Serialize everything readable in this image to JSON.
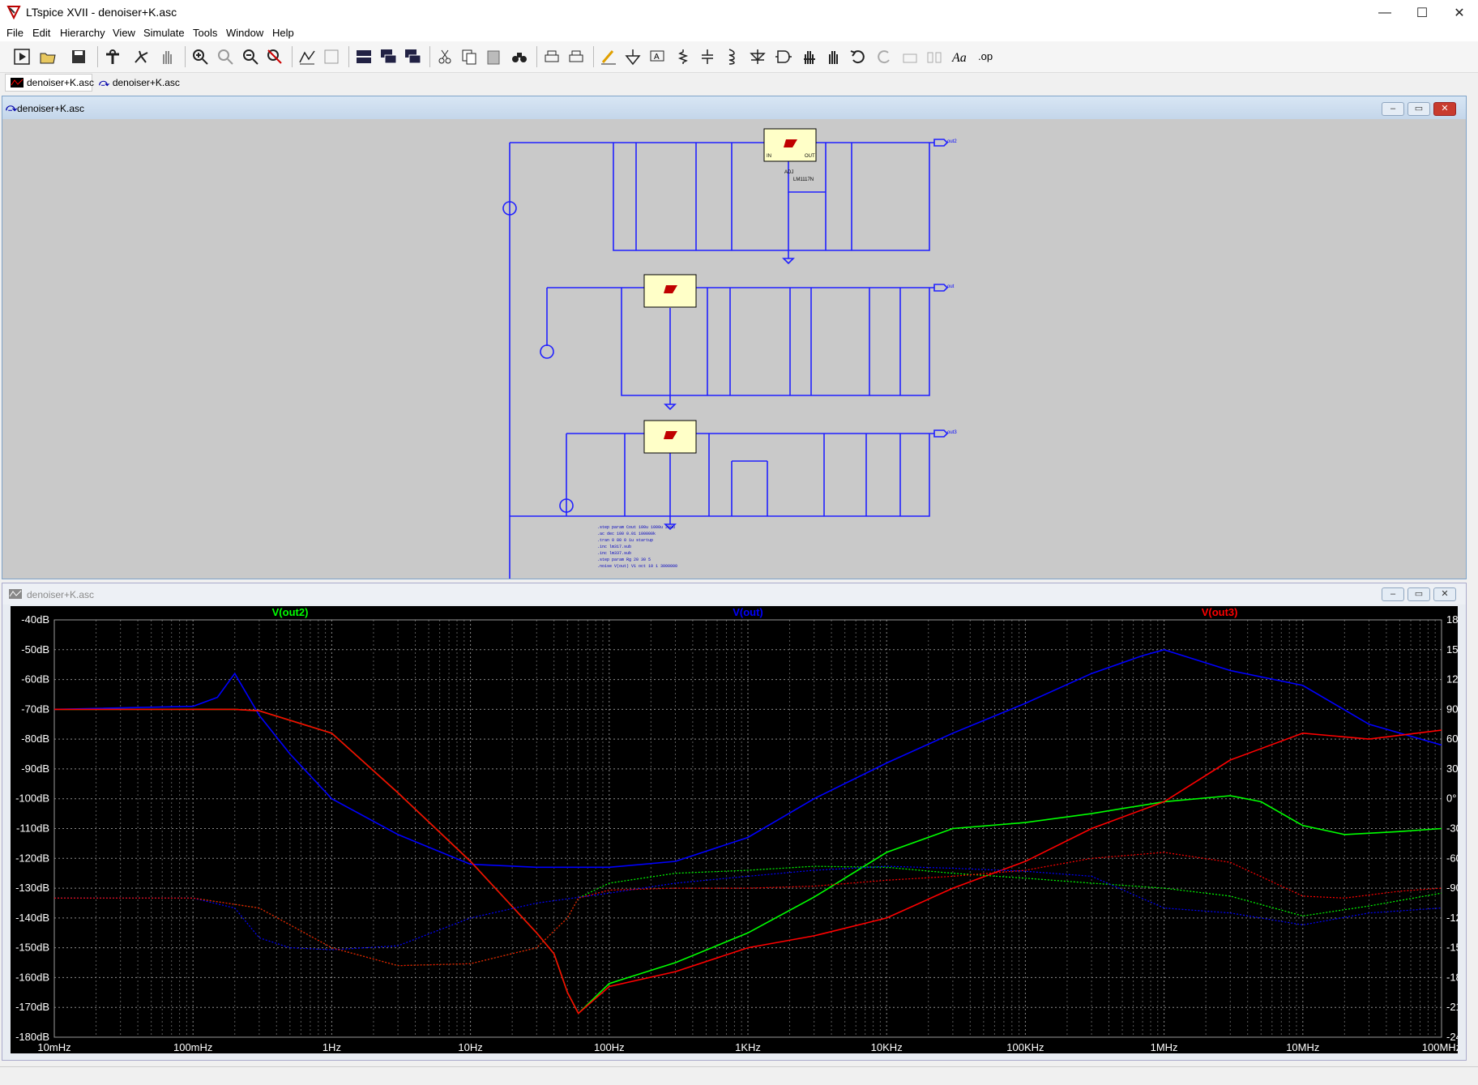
{
  "window": {
    "title": "LTspice XVII - denoiser+K.asc",
    "minimize": "—",
    "maximize": "☐",
    "close": "✕"
  },
  "menu": [
    {
      "label": "File"
    },
    {
      "label": "Edit"
    },
    {
      "label": "Hierarchy"
    },
    {
      "label": "View"
    },
    {
      "label": "Simulate"
    },
    {
      "label": "Tools"
    },
    {
      "label": "Window"
    },
    {
      "label": "Help"
    }
  ],
  "tabs": [
    {
      "label": "denoiser+K.asc",
      "icon": "waveform-icon"
    },
    {
      "label": "denoiser+K.asc",
      "icon": "schematic-icon"
    }
  ],
  "schematic": {
    "title": "denoiser+K.asc",
    "directives": [
      ".step param Cout 100u 1000u 200u",
      ".ac dec 100 0.01 100000k",
      ".tran 0 80 0 1u startup",
      ".inc lm317.sub",
      ".inc lm337.sub",
      ".step param Rg 20 30 5",
      ".noise V(out) V1 oct 10 1 3000000"
    ],
    "reg_labels": [
      "IN",
      "OUT",
      "ADJ",
      "LM1117N"
    ],
    "out_labels": [
      "out2",
      "out",
      "out3"
    ]
  },
  "plot": {
    "title": "denoiser+K.asc",
    "traces": [
      {
        "name": "V(out2)",
        "color": "#00ff00"
      },
      {
        "name": "V(out)",
        "color": "#0000ff"
      },
      {
        "name": "V(out3)",
        "color": "#ff0000"
      }
    ],
    "y_left": [
      "-40dB",
      "-50dB",
      "-60dB",
      "-70dB",
      "-80dB",
      "-90dB",
      "-100dB",
      "-110dB",
      "-120dB",
      "-130dB",
      "-140dB",
      "-150dB",
      "-160dB",
      "-170dB",
      "-180dB"
    ],
    "y_right": [
      "180°",
      "150°",
      "120°",
      "90°",
      "60°",
      "30°",
      "0°",
      "-30°",
      "-60°",
      "-90°",
      "-120°",
      "-150°",
      "-180°",
      "-210°",
      "-240°"
    ],
    "x_labels": [
      "10mHz",
      "100mHz",
      "1Hz",
      "10Hz",
      "100Hz",
      "1KHz",
      "10KHz",
      "100KHz",
      "1MHz",
      "10MHz",
      "100MHz"
    ]
  },
  "chart_data": {
    "type": "line",
    "x_scale": "log",
    "xlim_hz": [
      0.01,
      100000000
    ],
    "ylim_db": [
      -180,
      -40
    ],
    "ylim_phase_deg": [
      -240,
      180
    ],
    "grid": true,
    "series": [
      {
        "name": "V(out2)",
        "color": "#00ff00",
        "axis": "magnitude",
        "x": [
          0.01,
          0.1,
          0.2,
          0.3,
          1,
          3,
          10,
          30,
          40,
          50,
          60,
          100,
          300,
          1000,
          3000,
          10000,
          30000,
          100000,
          300000,
          1000000,
          3000000,
          5000000,
          10000000,
          20000000,
          50000000,
          100000000
        ],
        "y": [
          -70,
          -70,
          -70,
          -70.5,
          -78,
          -98,
          -121,
          -145,
          -152,
          -165,
          -172,
          -162,
          -155,
          -145,
          -133,
          -118,
          -110,
          -108,
          -105,
          -101,
          -99,
          -101,
          -109,
          -112,
          -111,
          -110
        ]
      },
      {
        "name": "V(out)",
        "color": "#0000ff",
        "axis": "magnitude",
        "x": [
          0.01,
          0.1,
          0.15,
          0.2,
          0.3,
          0.5,
          1,
          3,
          10,
          30,
          100,
          300,
          1000,
          3000,
          10000,
          30000,
          100000,
          300000,
          700000,
          1000000,
          3000000,
          10000000,
          30000000,
          100000000
        ],
        "y": [
          -70,
          -69,
          -66,
          -58,
          -72,
          -85,
          -100,
          -112,
          -122,
          -123,
          -123,
          -121,
          -113,
          -100,
          -88,
          -78,
          -68,
          -58,
          -52,
          -50,
          -57,
          -62,
          -75,
          -82
        ]
      },
      {
        "name": "V(out3)",
        "color": "#ff0000",
        "axis": "magnitude",
        "x": [
          0.01,
          0.1,
          0.2,
          0.3,
          1,
          3,
          10,
          30,
          40,
          50,
          60,
          100,
          300,
          1000,
          3000,
          10000,
          30000,
          100000,
          300000,
          1000000,
          3000000,
          10000000,
          30000000,
          100000000
        ],
        "y": [
          -70,
          -70,
          -70,
          -70.5,
          -78,
          -98,
          -121,
          -145,
          -152,
          -165,
          -172,
          -163,
          -158,
          -150,
          -146,
          -140,
          -130,
          -121,
          -110,
          -101,
          -87,
          -78,
          -80,
          -77
        ]
      },
      {
        "name": "V(out2) phase",
        "color": "#00ff00",
        "axis": "phase",
        "x": [
          0.01,
          0.1,
          0.3,
          1,
          3,
          10,
          30,
          50,
          60,
          100,
          300,
          1000,
          3000,
          10000,
          30000,
          100000,
          300000,
          1000000,
          3000000,
          10000000,
          30000000,
          100000000
        ],
        "y": [
          -100,
          -100,
          -110,
          -150,
          -168,
          -166,
          -150,
          -120,
          -100,
          -85,
          -75,
          -72,
          -68,
          -69,
          -75,
          -80,
          -85,
          -90,
          -98,
          -118,
          -108,
          -95
        ]
      },
      {
        "name": "V(out) phase",
        "color": "#0000ff",
        "axis": "phase",
        "x": [
          0.01,
          0.1,
          0.2,
          0.3,
          0.5,
          1,
          3,
          10,
          30,
          100,
          300,
          1000,
          3000,
          10000,
          30000,
          100000,
          300000,
          1000000,
          3000000,
          10000000,
          30000000,
          100000000
        ],
        "y": [
          -100,
          -100,
          -110,
          -140,
          -150,
          -152,
          -148,
          -120,
          -105,
          -95,
          -85,
          -78,
          -72,
          -68,
          -70,
          -73,
          -78,
          -110,
          -115,
          -127,
          -115,
          -110
        ]
      },
      {
        "name": "V(out3) phase",
        "color": "#ff0000",
        "axis": "phase",
        "x": [
          0.01,
          0.1,
          0.3,
          1,
          3,
          10,
          30,
          50,
          60,
          100,
          300,
          1000,
          3000,
          10000,
          30000,
          100000,
          300000,
          1000000,
          3000000,
          10000000,
          20000000,
          50000000,
          100000000
        ],
        "y": [
          -100,
          -100,
          -110,
          -150,
          -168,
          -166,
          -150,
          -120,
          -100,
          -92,
          -90,
          -90,
          -88,
          -82,
          -78,
          -72,
          -60,
          -54,
          -64,
          -98,
          -100,
          -93,
          -90
        ]
      }
    ]
  }
}
